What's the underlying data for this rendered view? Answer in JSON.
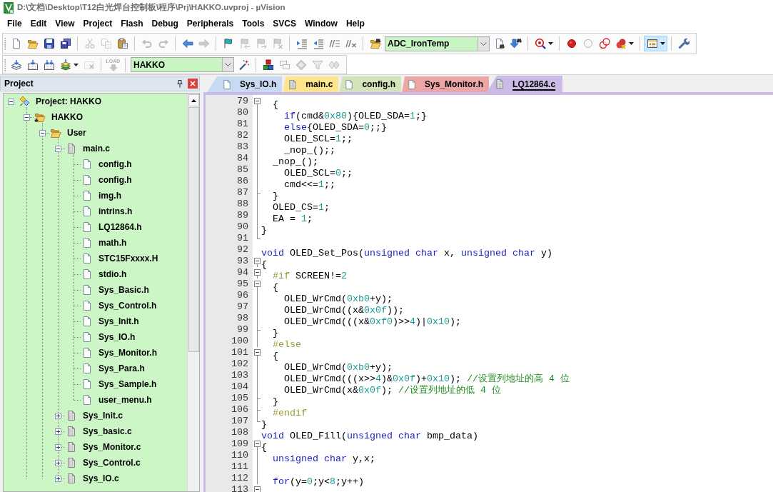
{
  "window": {
    "title": "D:\\文档\\Desktop\\T12白光焊台控制板\\程序\\Prj\\HAKKO.uvproj - µVision"
  },
  "menu": [
    "File",
    "Edit",
    "View",
    "Project",
    "Flash",
    "Debug",
    "Peripherals",
    "Tools",
    "SVCS",
    "Window",
    "Help"
  ],
  "toolbars": [
    {
      "items": [
        {
          "kind": "button",
          "disabled": false,
          "pressed": false
        },
        {
          "kind": "button",
          "disabled": false,
          "pressed": false
        },
        {
          "kind": "button",
          "disabled": false,
          "pressed": false
        },
        {
          "kind": "button",
          "disabled": false,
          "pressed": false
        },
        {
          "kind": "separator"
        },
        {
          "kind": "button",
          "disabled": true,
          "pressed": false
        },
        {
          "kind": "button",
          "disabled": true,
          "pressed": false
        },
        {
          "kind": "button",
          "disabled": false,
          "pressed": false
        },
        {
          "kind": "separator"
        },
        {
          "kind": "button",
          "disabled": true,
          "pressed": false
        },
        {
          "kind": "button",
          "disabled": true,
          "pressed": false
        },
        {
          "kind": "separator"
        },
        {
          "kind": "button",
          "disabled": false,
          "pressed": false
        },
        {
          "kind": "button",
          "disabled": true,
          "pressed": false
        },
        {
          "kind": "separator"
        },
        {
          "kind": "button",
          "disabled": false,
          "pressed": false
        },
        {
          "kind": "button",
          "disabled": true,
          "pressed": false
        },
        {
          "kind": "button",
          "disabled": true,
          "pressed": false
        },
        {
          "kind": "button",
          "disabled": true,
          "pressed": false
        },
        {
          "kind": "separator"
        },
        {
          "kind": "button",
          "disabled": false,
          "pressed": false
        },
        {
          "kind": "button",
          "disabled": false,
          "pressed": false
        },
        {
          "kind": "button",
          "disabled": false,
          "pressed": false
        },
        {
          "kind": "button",
          "disabled": false,
          "pressed": false
        },
        {
          "kind": "separator"
        },
        {
          "kind": "button",
          "disabled": false,
          "pressed": false
        },
        {
          "kind": "combo",
          "value": "ADC_IronTemp"
        },
        {
          "kind": "button",
          "disabled": false,
          "pressed": false
        },
        {
          "kind": "button",
          "disabled": false,
          "pressed": false
        },
        {
          "kind": "separator"
        },
        {
          "kind": "split",
          "disabled": false,
          "pressed": false
        },
        {
          "kind": "separator"
        },
        {
          "kind": "button",
          "disabled": false,
          "pressed": false
        },
        {
          "kind": "button",
          "disabled": false,
          "pressed": false
        },
        {
          "kind": "button",
          "disabled": false,
          "pressed": false
        },
        {
          "kind": "split",
          "disabled": false,
          "pressed": false
        },
        {
          "kind": "separator"
        },
        {
          "kind": "split",
          "disabled": false,
          "pressed": true
        },
        {
          "kind": "separator"
        },
        {
          "kind": "button",
          "disabled": false,
          "pressed": false
        }
      ]
    },
    {
      "items": [
        {
          "kind": "button",
          "disabled": false,
          "pressed": false
        },
        {
          "kind": "button",
          "disabled": false,
          "pressed": false
        },
        {
          "kind": "button",
          "disabled": false,
          "pressed": false
        },
        {
          "kind": "split",
          "disabled": false,
          "pressed": false
        },
        {
          "kind": "button",
          "disabled": true,
          "pressed": false
        },
        {
          "kind": "separator"
        },
        {
          "kind": "button",
          "label": "LOAD",
          "disabled": true,
          "pressed": false
        },
        {
          "kind": "separator"
        },
        {
          "kind": "combo",
          "value": "HAKKO"
        },
        {
          "kind": "button",
          "disabled": false,
          "pressed": false
        },
        {
          "kind": "separator"
        },
        {
          "kind": "button",
          "disabled": false,
          "pressed": false
        },
        {
          "kind": "button",
          "disabled": true,
          "pressed": false
        },
        {
          "kind": "button",
          "disabled": true,
          "pressed": false
        },
        {
          "kind": "button",
          "disabled": true,
          "pressed": false
        },
        {
          "kind": "button",
          "disabled": true,
          "pressed": false
        }
      ]
    }
  ],
  "project_panel": {
    "title": "Project",
    "tree": [
      {
        "label": "Project: HAKKO",
        "kind": "project",
        "expanded": true,
        "children": [
          {
            "label": "HAKKO",
            "kind": "target",
            "expanded": true,
            "children": [
              {
                "label": "User",
                "kind": "group",
                "expanded": true,
                "children": [
                  {
                    "label": "main.c",
                    "kind": "source",
                    "expanded": true,
                    "children": [
                      {
                        "label": "config.h",
                        "kind": "header"
                      },
                      {
                        "label": "config.h",
                        "kind": "header"
                      },
                      {
                        "label": "img.h",
                        "kind": "header"
                      },
                      {
                        "label": "intrins.h",
                        "kind": "header"
                      },
                      {
                        "label": "LQ12864.h",
                        "kind": "header"
                      },
                      {
                        "label": "math.h",
                        "kind": "header"
                      },
                      {
                        "label": "STC15Fxxxx.H",
                        "kind": "header"
                      },
                      {
                        "label": "stdio.h",
                        "kind": "header"
                      },
                      {
                        "label": "Sys_Basic.h",
                        "kind": "header"
                      },
                      {
                        "label": "Sys_Control.h",
                        "kind": "header"
                      },
                      {
                        "label": "Sys_Init.h",
                        "kind": "header"
                      },
                      {
                        "label": "Sys_IO.h",
                        "kind": "header"
                      },
                      {
                        "label": "Sys_Monitor.h",
                        "kind": "header"
                      },
                      {
                        "label": "Sys_Para.h",
                        "kind": "header"
                      },
                      {
                        "label": "Sys_Sample.h",
                        "kind": "header"
                      },
                      {
                        "label": "user_menu.h",
                        "kind": "header"
                      }
                    ]
                  },
                  {
                    "label": "Sys_Init.c",
                    "kind": "source",
                    "expanded": false
                  },
                  {
                    "label": "Sys_basic.c",
                    "kind": "source",
                    "expanded": false
                  },
                  {
                    "label": "Sys_Monitor.c",
                    "kind": "source",
                    "expanded": false
                  },
                  {
                    "label": "Sys_Control.c",
                    "kind": "source",
                    "expanded": false
                  },
                  {
                    "label": "Sys_IO.c",
                    "kind": "source",
                    "expanded": false
                  }
                ]
              }
            ]
          }
        ]
      }
    ]
  },
  "editor": {
    "tabs": [
      {
        "label": "Sys_IO.h",
        "kind": "header",
        "color": "#c8daf2",
        "selected": false
      },
      {
        "label": "main.c",
        "kind": "source",
        "color": "#fde58c",
        "selected": false
      },
      {
        "label": "config.h",
        "kind": "header",
        "color": "#d5e3bb",
        "selected": false
      },
      {
        "label": "Sys_Monitor.h",
        "kind": "header",
        "color": "#eda6a6",
        "selected": false
      },
      {
        "label": "LQ12864.c",
        "kind": "source",
        "color": "#cbbbe6",
        "selected": true
      }
    ],
    "lines": [
      {
        "number": "79",
        "kind": "fold-start",
        "tokens": [
          {
            "kind": "plain",
            "text": "  {"
          }
        ]
      },
      {
        "number": "80",
        "kind": "fold-body",
        "tokens": [
          {
            "kind": "keyword",
            "text": "    if"
          },
          {
            "kind": "plain",
            "text": "(cmd&"
          },
          {
            "kind": "number",
            "text": "0x80"
          },
          {
            "kind": "plain",
            "text": "){OLED_SDA="
          },
          {
            "kind": "number",
            "text": "1"
          },
          {
            "kind": "plain",
            "text": ";}"
          }
        ]
      },
      {
        "number": "81",
        "kind": "fold-body",
        "tokens": [
          {
            "kind": "keyword",
            "text": "    else"
          },
          {
            "kind": "plain",
            "text": "{OLED_SDA="
          },
          {
            "kind": "number",
            "text": "0"
          },
          {
            "kind": "plain",
            "text": ";;}"
          }
        ]
      },
      {
        "number": "82",
        "kind": "fold-body",
        "tokens": [
          {
            "kind": "plain",
            "text": "    OLED_SCL="
          },
          {
            "kind": "number",
            "text": "1"
          },
          {
            "kind": "plain",
            "text": ";;"
          }
        ]
      },
      {
        "number": "83",
        "kind": "fold-body",
        "tokens": [
          {
            "kind": "plain",
            "text": "    _nop_();;"
          }
        ]
      },
      {
        "number": "84",
        "kind": "fold-body",
        "tokens": [
          {
            "kind": "plain",
            "text": "  _nop_();"
          }
        ]
      },
      {
        "number": "85",
        "kind": "fold-body",
        "tokens": [
          {
            "kind": "plain",
            "text": "    OLED_SCL="
          },
          {
            "kind": "number",
            "text": "0"
          },
          {
            "kind": "plain",
            "text": ";;"
          }
        ]
      },
      {
        "number": "86",
        "kind": "fold-body",
        "tokens": [
          {
            "kind": "plain",
            "text": "    cmd<<="
          },
          {
            "kind": "number",
            "text": "1"
          },
          {
            "kind": "plain",
            "text": ";;"
          }
        ]
      },
      {
        "number": "87",
        "kind": "fold-branch-end",
        "tokens": [
          {
            "kind": "plain",
            "text": "  }"
          }
        ]
      },
      {
        "number": "88",
        "kind": "fold-body",
        "tokens": [
          {
            "kind": "plain",
            "text": "  OLED_CS="
          },
          {
            "kind": "number",
            "text": "1"
          },
          {
            "kind": "plain",
            "text": ";"
          }
        ]
      },
      {
        "number": "89",
        "kind": "fold-body",
        "tokens": [
          {
            "kind": "plain",
            "text": "  EA = "
          },
          {
            "kind": "number",
            "text": "1"
          },
          {
            "kind": "plain",
            "text": ";"
          }
        ]
      },
      {
        "number": "90",
        "kind": "fold-body",
        "tokens": [
          {
            "kind": "plain",
            "text": "}"
          }
        ]
      },
      {
        "number": "91",
        "kind": "fold-end"
      },
      {
        "number": "92",
        "kind": "plain",
        "tokens": [
          {
            "kind": "keyword",
            "text": "void"
          },
          {
            "kind": "plain",
            "text": " OLED_Set_Pos("
          },
          {
            "kind": "keyword",
            "text": "unsigned char"
          },
          {
            "kind": "plain",
            "text": " x, "
          },
          {
            "kind": "keyword",
            "text": "unsigned char"
          },
          {
            "kind": "plain",
            "text": " y)"
          }
        ]
      },
      {
        "number": "93",
        "kind": "fold-start",
        "tokens": [
          {
            "kind": "plain",
            "text": "{"
          }
        ]
      },
      {
        "number": "94",
        "kind": "fold-start",
        "tokens": [
          {
            "kind": "preproc",
            "text": "  #if"
          },
          {
            "kind": "plain",
            "text": " SCREEN!="
          },
          {
            "kind": "number",
            "text": "2"
          }
        ]
      },
      {
        "number": "95",
        "kind": "fold-start",
        "tokens": [
          {
            "kind": "plain",
            "text": "  {"
          }
        ]
      },
      {
        "number": "96",
        "kind": "fold-body",
        "tokens": [
          {
            "kind": "plain",
            "text": "    OLED_WrCmd("
          },
          {
            "kind": "number",
            "text": "0xb0"
          },
          {
            "kind": "plain",
            "text": "+y);"
          }
        ]
      },
      {
        "number": "97",
        "kind": "fold-body",
        "tokens": [
          {
            "kind": "plain",
            "text": "    OLED_WrCmd((x&"
          },
          {
            "kind": "number",
            "text": "0x0f"
          },
          {
            "kind": "plain",
            "text": "));"
          }
        ]
      },
      {
        "number": "98",
        "kind": "fold-body",
        "tokens": [
          {
            "kind": "plain",
            "text": "    OLED_WrCmd(((x&"
          },
          {
            "kind": "number",
            "text": "0xf0"
          },
          {
            "kind": "plain",
            "text": ")>>"
          },
          {
            "kind": "number",
            "text": "4"
          },
          {
            "kind": "plain",
            "text": ")|"
          },
          {
            "kind": "number",
            "text": "0x10"
          },
          {
            "kind": "plain",
            "text": ");"
          }
        ]
      },
      {
        "number": "99",
        "kind": "fold-branch-end",
        "tokens": [
          {
            "kind": "plain",
            "text": "  }"
          }
        ]
      },
      {
        "number": "100",
        "kind": "fold-body",
        "tokens": [
          {
            "kind": "preproc",
            "text": "  #else"
          }
        ]
      },
      {
        "number": "101",
        "kind": "fold-start",
        "tokens": [
          {
            "kind": "plain",
            "text": "  {"
          }
        ]
      },
      {
        "number": "102",
        "kind": "fold-body",
        "tokens": [
          {
            "kind": "plain",
            "text": "    OLED_WrCmd("
          },
          {
            "kind": "number",
            "text": "0xb0"
          },
          {
            "kind": "plain",
            "text": "+y);"
          }
        ]
      },
      {
        "number": "103",
        "kind": "fold-body",
        "tokens": [
          {
            "kind": "plain",
            "text": "    OLED_WrCmd(((x>>"
          },
          {
            "kind": "number",
            "text": "4"
          },
          {
            "kind": "plain",
            "text": ")&"
          },
          {
            "kind": "number",
            "text": "0x0f"
          },
          {
            "kind": "plain",
            "text": ")+"
          },
          {
            "kind": "number",
            "text": "0x10"
          },
          {
            "kind": "plain",
            "text": "); "
          },
          {
            "kind": "comment",
            "text": "//设置列地址的高 4 位"
          }
        ]
      },
      {
        "number": "104",
        "kind": "fold-body",
        "tokens": [
          {
            "kind": "plain",
            "text": "    OLED_WrCmd(x&"
          },
          {
            "kind": "number",
            "text": "0x0f"
          },
          {
            "kind": "plain",
            "text": "); "
          },
          {
            "kind": "comment",
            "text": "//设置列地址的低 4 位"
          }
        ]
      },
      {
        "number": "105",
        "kind": "fold-branch-end",
        "tokens": [
          {
            "kind": "plain",
            "text": "  }"
          }
        ]
      },
      {
        "number": "106",
        "kind": "fold-branch-end",
        "tokens": [
          {
            "kind": "preproc",
            "text": "  #endif"
          }
        ]
      },
      {
        "number": "107",
        "kind": "fold-end",
        "tokens": [
          {
            "kind": "plain",
            "text": "}"
          }
        ]
      },
      {
        "number": "108",
        "kind": "plain",
        "tokens": [
          {
            "kind": "keyword",
            "text": "void"
          },
          {
            "kind": "plain",
            "text": " OLED_Fill("
          },
          {
            "kind": "keyword",
            "text": "unsigned char"
          },
          {
            "kind": "plain",
            "text": " bmp_data)"
          }
        ]
      },
      {
        "number": "109",
        "kind": "fold-start",
        "tokens": [
          {
            "kind": "plain",
            "text": "{"
          }
        ]
      },
      {
        "number": "110",
        "kind": "fold-body",
        "tokens": [
          {
            "kind": "keyword",
            "text": "  unsigned char"
          },
          {
            "kind": "plain",
            "text": " y,x;"
          }
        ]
      },
      {
        "number": "111",
        "kind": "fold-body"
      },
      {
        "number": "112",
        "kind": "fold-body",
        "tokens": [
          {
            "kind": "keyword",
            "text": "  for"
          },
          {
            "kind": "plain",
            "text": "(y="
          },
          {
            "kind": "number",
            "text": "0"
          },
          {
            "kind": "plain",
            "text": ";y<"
          },
          {
            "kind": "number",
            "text": "8"
          },
          {
            "kind": "plain",
            "text": ";y++)"
          }
        ]
      },
      {
        "number": "113",
        "kind": "fold-start"
      }
    ]
  }
}
